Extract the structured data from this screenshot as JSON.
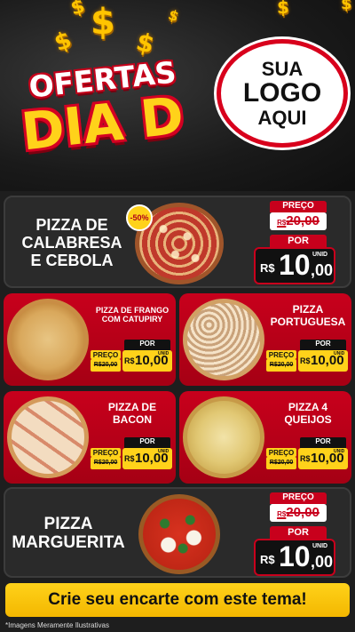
{
  "header": {
    "headline_top": "OFERTAS",
    "headline_bottom": "DIA D",
    "logo_line1": "SUA",
    "logo_line2": "LOGO",
    "logo_line3": "AQUI",
    "dollar_symbol": "$"
  },
  "colors": {
    "brand_red": "#c8001c",
    "brand_yellow": "#ffd21a",
    "dark_card": "#2a2a2a"
  },
  "featured_top": {
    "name_line1": "PIZZA DE",
    "name_line2": "CALABRESA",
    "name_line3": "E CEBOLA",
    "discount_badge": "-50%",
    "price_label": "PREÇO",
    "old_currency": "R$",
    "old_price": "20,00",
    "por_label": "POR",
    "currency": "R$",
    "new_price_int": "10",
    "new_price_dec": ",00",
    "unit": "UNID"
  },
  "grid": [
    {
      "name_line1": "PIZZA DE FRANGO",
      "name_line2": "COM CATUPIRY",
      "preco_label": "PREÇO",
      "old_price": "R$20,00",
      "por_label": "POR",
      "currency": "R$",
      "new_price": "10,00",
      "unit": "UNID"
    },
    {
      "name_line1": "PIZZA",
      "name_line2": "PORTUGUESA",
      "preco_label": "PREÇO",
      "old_price": "R$20,00",
      "por_label": "POR",
      "currency": "R$",
      "new_price": "10,00",
      "unit": "UNID"
    },
    {
      "name_line1": "PIZZA DE",
      "name_line2": "BACON",
      "preco_label": "PREÇO",
      "old_price": "R$20,00",
      "por_label": "POR",
      "currency": "R$",
      "new_price": "10,00",
      "unit": "UNID"
    },
    {
      "name_line1": "PIZZA 4",
      "name_line2": "QUEIJOS",
      "preco_label": "PREÇO",
      "old_price": "R$20,00",
      "por_label": "POR",
      "currency": "R$",
      "new_price": "10,00",
      "unit": "UNID"
    }
  ],
  "featured_bottom": {
    "name_line1": "PIZZA",
    "name_line2": "MARGUERITA",
    "price_label": "PREÇO",
    "old_currency": "R$",
    "old_price": "20,00",
    "por_label": "POR",
    "currency": "R$",
    "new_price_int": "10",
    "new_price_dec": ",00",
    "unit": "UNID"
  },
  "cta": {
    "label": "Crie seu encarte com este tema!"
  },
  "disclaimer": "*Imagens Meramente Ilustrativas"
}
